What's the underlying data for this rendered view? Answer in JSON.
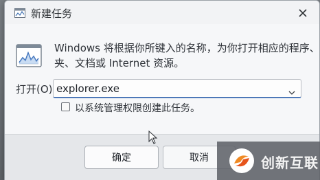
{
  "window": {
    "title": "新建任务",
    "close_icon": "close-icon",
    "title_icon": "run-dialog-icon"
  },
  "body": {
    "description_lines": [
      "Windows 将根据你所键入的名称，为你打开相应的程序、文件",
      "夹、文档或 Internet 资源。"
    ],
    "icon": "task-manager-run-icon"
  },
  "open_field": {
    "label": "打开(O):",
    "value": "explorer.exe",
    "dropdown_icon": "chevron-down-icon"
  },
  "admin_checkbox": {
    "checked": false,
    "label": "以系统管理权限创建此任务。"
  },
  "buttons": {
    "ok_label": "确定",
    "cancel_label": "取消"
  },
  "watermark": {
    "text": "创新互联"
  }
}
